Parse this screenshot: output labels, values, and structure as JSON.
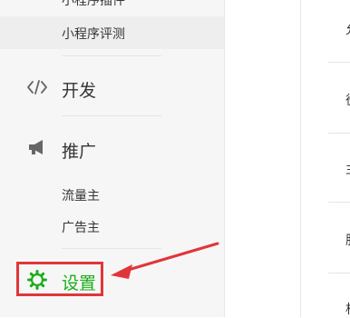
{
  "sidebar": {
    "top_partial_label": "小程序插件",
    "sub_items": {
      "review": "小程序评测",
      "traffic_owner": "流量主",
      "ad_owner": "广告主"
    },
    "sections": {
      "dev": "开发",
      "promote": "推广",
      "settings": "设置"
    }
  },
  "panel": {
    "partial_labels": [
      "允",
      "役",
      "主",
      "服",
      "相"
    ]
  },
  "colors": {
    "sidebar_bg": "#f6f6f6",
    "active_bg": "#eeeeee",
    "text": "#353535",
    "icon_gray": "#666666",
    "accent_green": "#1aad19",
    "annotation_red": "#e0363a"
  },
  "icons": {
    "dev": "code-icon",
    "promote": "megaphone-icon",
    "settings": "gear-icon",
    "annotation": "arrow-icon"
  }
}
